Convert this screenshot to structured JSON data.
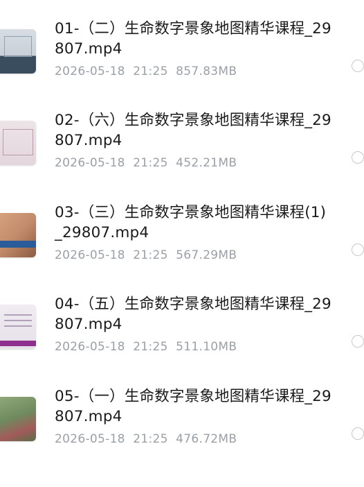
{
  "files": [
    {
      "name": "01-（二）生命数字景象地图精华课程_29807.mp4",
      "date": "2026-05-18",
      "time": "21:25",
      "size": "857.83MB",
      "thumb_color": "#c9d0d8",
      "thumb_accent": "#3a4d5e"
    },
    {
      "name": "02-（六）生命数字景象地图精华课程_29807.mp4",
      "date": "2026-05-18",
      "time": "21:25",
      "size": "452.21MB",
      "thumb_color": "#e3d6dc",
      "thumb_accent": "#8a6a78"
    },
    {
      "name": "03-（三）生命数字景象地图精华课程(1)_29807.mp4",
      "date": "2026-05-18",
      "time": "21:25",
      "size": "567.29MB",
      "thumb_color": "#c28a6a",
      "thumb_accent": "#2b5c9a"
    },
    {
      "name": "04-（五）生命数字景象地图精华课程_29807.mp4",
      "date": "2026-05-18",
      "time": "21:25",
      "size": "511.10MB",
      "thumb_color": "#e6e0e8",
      "thumb_accent": "#8e2f8e"
    },
    {
      "name": "05-（一）生命数字景象地图精华课程_29807.mp4",
      "date": "2026-05-18",
      "time": "21:25",
      "size": "476.72MB",
      "thumb_color": "#6f8a5e",
      "thumb_accent": "#a25a5a"
    }
  ]
}
